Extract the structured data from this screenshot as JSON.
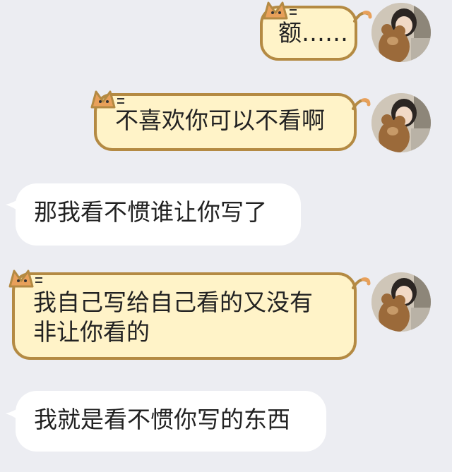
{
  "conversation": {
    "messages": [
      {
        "side": "right",
        "text": "额……"
      },
      {
        "side": "right",
        "text": "不喜欢你可以不看啊"
      },
      {
        "side": "left",
        "text": "那我看不惯谁让你写了"
      },
      {
        "side": "right",
        "text": "我自己写给自己看的又没有\n非让你看的"
      },
      {
        "side": "left",
        "text": "我就是看不惯你写的东西"
      }
    ]
  },
  "theme": {
    "bubble_fill": "#fff3c8",
    "bubble_border": "#b48a43",
    "cat_orange": "#e8a05a",
    "background": "#ecedf2",
    "incoming_fill": "#ffffff"
  },
  "icons": {
    "avatar": "avatar-girl-with-teddy-bear",
    "cat_ears": "cat-ears-icon",
    "cat_tail": "cat-tail-icon"
  }
}
